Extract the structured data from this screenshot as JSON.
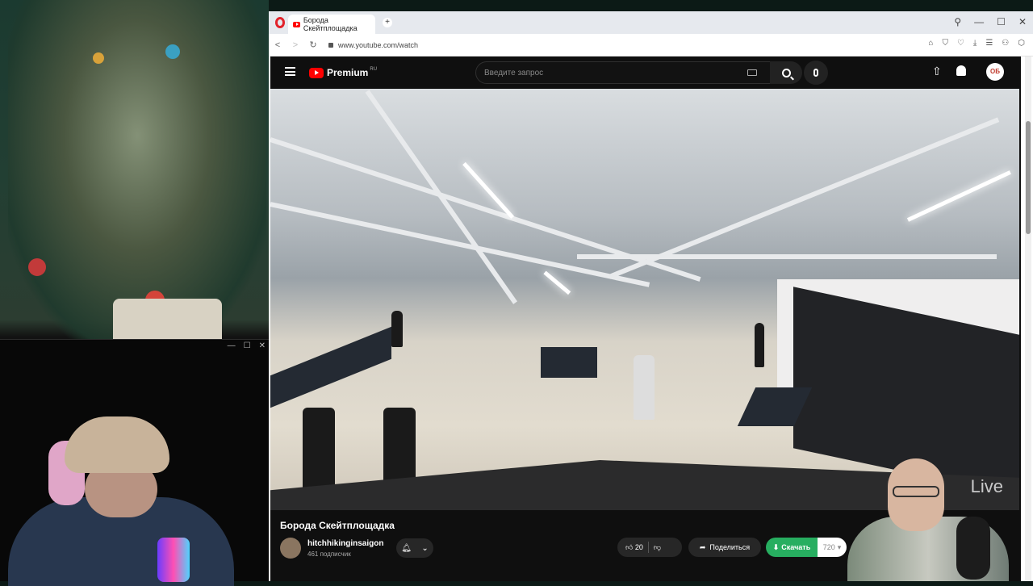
{
  "browser": {
    "tab_title": "Борода Скейтплощадка",
    "new_tab_symbol": "+",
    "url": "www.youtube.com/watch",
    "window_controls": [
      "⚲",
      "—",
      "☐",
      "✕"
    ],
    "toolbar_icons": [
      "⌂",
      "⛉",
      "♡",
      "⤓",
      "☰",
      "⚇",
      "⬡"
    ]
  },
  "webcam_window": {
    "controls": [
      "—",
      "☐",
      "✕"
    ]
  },
  "youtube": {
    "logo_text": "Premium",
    "logo_region": "RU",
    "search_placeholder": "Введите запрос",
    "avatar_initials": "ОБ"
  },
  "video": {
    "title": "Борода Скейтплощадка",
    "channel_name": "hitchhikinginsaigon",
    "subscribers": "461 подписчик",
    "likes": "20",
    "share_label": "Поделиться",
    "download_label": "Скачать",
    "quality": "720",
    "watermark": "Live"
  },
  "colors": {
    "youtube_red": "#ff0000",
    "download_green": "#27ae60",
    "opera_red": "#e2222a"
  }
}
